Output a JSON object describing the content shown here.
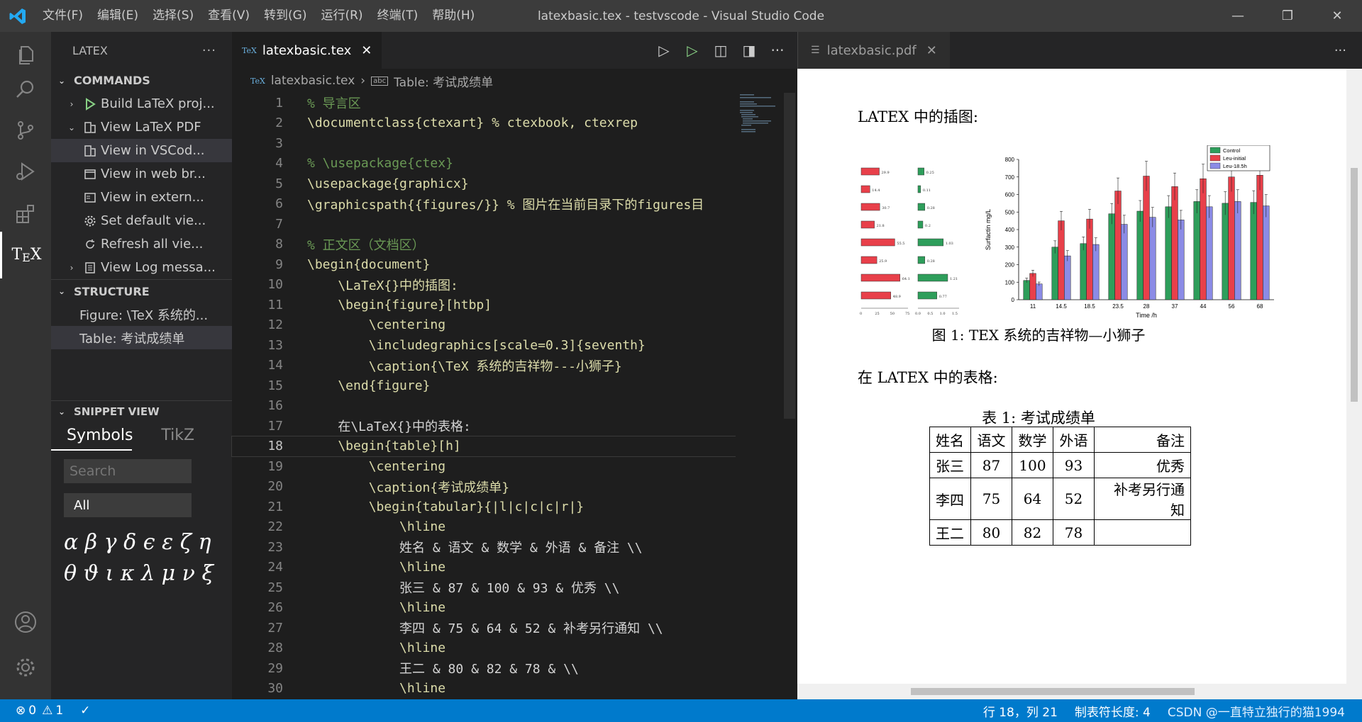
{
  "titlebar": {
    "menus": [
      "文件(F)",
      "编辑(E)",
      "选择(S)",
      "查看(V)",
      "转到(G)",
      "运行(R)",
      "终端(T)",
      "帮助(H)"
    ],
    "window_title": "latexbasic.tex - testvscode - Visual Studio Code"
  },
  "sidebar": {
    "title": "LATEX",
    "commands_header": "COMMANDS",
    "commands": [
      {
        "label": "Build LaTeX proj..."
      },
      {
        "label": "View LaTeX PDF"
      },
      {
        "label": "View in VSCod..."
      },
      {
        "label": "View in web br..."
      },
      {
        "label": "View in extern..."
      },
      {
        "label": "Set default vie..."
      },
      {
        "label": "Refresh all vie..."
      },
      {
        "label": "View Log messa..."
      }
    ],
    "structure_header": "STRUCTURE",
    "structure": [
      {
        "label": "Figure:  \\TeX 系统的..."
      },
      {
        "label": "Table:  考试成绩单"
      }
    ],
    "snippet_header": "SNIPPET VIEW",
    "snippet_tabs": [
      "Symbols",
      "TikZ"
    ],
    "search_placeholder": "Search",
    "filter_value": "All",
    "symbols_row1": "α β γ δ ϵ ε ζ η",
    "symbols_row2": "θ ϑ ι κ λ μ ν ξ"
  },
  "editor": {
    "tab_label": "latexbasic.tex",
    "tab_icon": "TeX",
    "breadcrumb_file": "latexbasic.tex",
    "breadcrumb_symbol": "Table:  考试成绩单",
    "cursor_line": 18,
    "lines": [
      {
        "n": "1",
        "t": "% 导言区"
      },
      {
        "n": "2",
        "t": "\\documentclass{ctexart} % ctexbook, ctexrep"
      },
      {
        "n": "3",
        "t": ""
      },
      {
        "n": "4",
        "t": "% \\usepackage{ctex}"
      },
      {
        "n": "5",
        "t": "\\usepackage{graphicx}"
      },
      {
        "n": "6",
        "t": "\\graphicspath{{figures/}} % 图片在当前目录下的figures目"
      },
      {
        "n": "7",
        "t": ""
      },
      {
        "n": "8",
        "t": "% 正文区（文档区）"
      },
      {
        "n": "9",
        "t": "\\begin{document}"
      },
      {
        "n": "10",
        "t": "    \\LaTeX{}中的插图:"
      },
      {
        "n": "11",
        "t": "    \\begin{figure}[htbp]"
      },
      {
        "n": "12",
        "t": "        \\centering"
      },
      {
        "n": "13",
        "t": "        \\includegraphics[scale=0.3]{seventh}"
      },
      {
        "n": "14",
        "t": "        \\caption{\\TeX 系统的吉祥物---小狮子}"
      },
      {
        "n": "15",
        "t": "    \\end{figure}"
      },
      {
        "n": "16",
        "t": ""
      },
      {
        "n": "17",
        "t": "    在\\LaTeX{}中的表格:"
      },
      {
        "n": "18",
        "t": "    \\begin{table}[h]"
      },
      {
        "n": "19",
        "t": "        \\centering"
      },
      {
        "n": "20",
        "t": "        \\caption{考试成绩单}"
      },
      {
        "n": "21",
        "t": "        \\begin{tabular}{|l|c|c|c|r|}"
      },
      {
        "n": "22",
        "t": "            \\hline"
      },
      {
        "n": "23",
        "t": "            姓名 & 语文 & 数学 & 外语 & 备注 \\\\"
      },
      {
        "n": "24",
        "t": "            \\hline"
      },
      {
        "n": "25",
        "t": "            张三 & 87 & 100 & 93 & 优秀 \\\\"
      },
      {
        "n": "26",
        "t": "            \\hline"
      },
      {
        "n": "27",
        "t": "            李四 & 75 & 64 & 52 & 补考另行通知 \\\\"
      },
      {
        "n": "28",
        "t": "            \\hline"
      },
      {
        "n": "29",
        "t": "            王二 & 80 & 82 & 78 & \\\\"
      },
      {
        "n": "30",
        "t": "            \\hline"
      }
    ]
  },
  "pdf": {
    "tab_label": "latexbasic.pdf",
    "heading1": "LATEX 中的插图:",
    "figure_caption": "图 1: TEX 系统的吉祥物—小狮子",
    "heading2": "在 LATEX 中的表格:",
    "table_caption": "表 1: 考试成绩单",
    "table_header": [
      "姓名",
      "语文",
      "数学",
      "外语",
      "备注"
    ],
    "table_rows": [
      [
        "张三",
        "87",
        "100",
        "93",
        "优秀"
      ],
      [
        "李四",
        "75",
        "64",
        "52",
        "补考另行通知"
      ],
      [
        "王二",
        "80",
        "82",
        "78",
        ""
      ]
    ],
    "chart_left_labels": [
      "29.9",
      "14.4",
      "30.7",
      "21.8",
      "55.5",
      "25.9",
      "64.1",
      "48.9"
    ],
    "chart_mid_labels": [
      "0.25",
      "0.11",
      "0.28",
      "0.2",
      "1.03",
      "0.28",
      "1.21",
      "0.77"
    ],
    "chart_left_ticks": [
      "0",
      "25",
      "50",
      "75"
    ],
    "chart_mid_ticks": [
      "0.0",
      "0.5",
      "1.0",
      "1.5"
    ],
    "chart_ylabel": "Surfactin mg/L",
    "chart_xlabel": "Time /h",
    "chart_legend": [
      "Control",
      "Leu-initial",
      "Leu-18.5h"
    ],
    "chart_yticks": [
      "0",
      "100",
      "200",
      "300",
      "400",
      "500",
      "600",
      "700",
      "800"
    ],
    "chart_xticks": [
      "11",
      "14.5",
      "18.5",
      "23.5",
      "28",
      "37",
      "44",
      "56",
      "68"
    ]
  },
  "chart_data": {
    "type": "bar",
    "categories": [
      "11",
      "14.5",
      "18.5",
      "23.5",
      "28",
      "37",
      "44",
      "56",
      "68"
    ],
    "series": [
      {
        "name": "Control",
        "values": [
          110,
          300,
          320,
          490,
          505,
          530,
          560,
          550,
          555
        ]
      },
      {
        "name": "Leu-initial",
        "values": [
          150,
          450,
          460,
          620,
          705,
          645,
          690,
          700,
          710
        ]
      },
      {
        "name": "Leu-18.5h",
        "values": [
          90,
          250,
          315,
          430,
          470,
          455,
          530,
          560,
          535
        ]
      }
    ],
    "xlabel": "Time /h",
    "ylabel": "Surfactin mg/L",
    "ylim": [
      0,
      800
    ],
    "colors": {
      "Control": "#2e9e5b",
      "Leu-initial": "#e8404a",
      "Leu-18.5h": "#8b8be6"
    },
    "legend": "top-right"
  },
  "statusbar": {
    "errors": "0",
    "warnings": "1",
    "position": "行 18，列 21",
    "tab_size": "制表符长度: 4",
    "watermark": "CSDN @一直特立独行的猫1994"
  }
}
